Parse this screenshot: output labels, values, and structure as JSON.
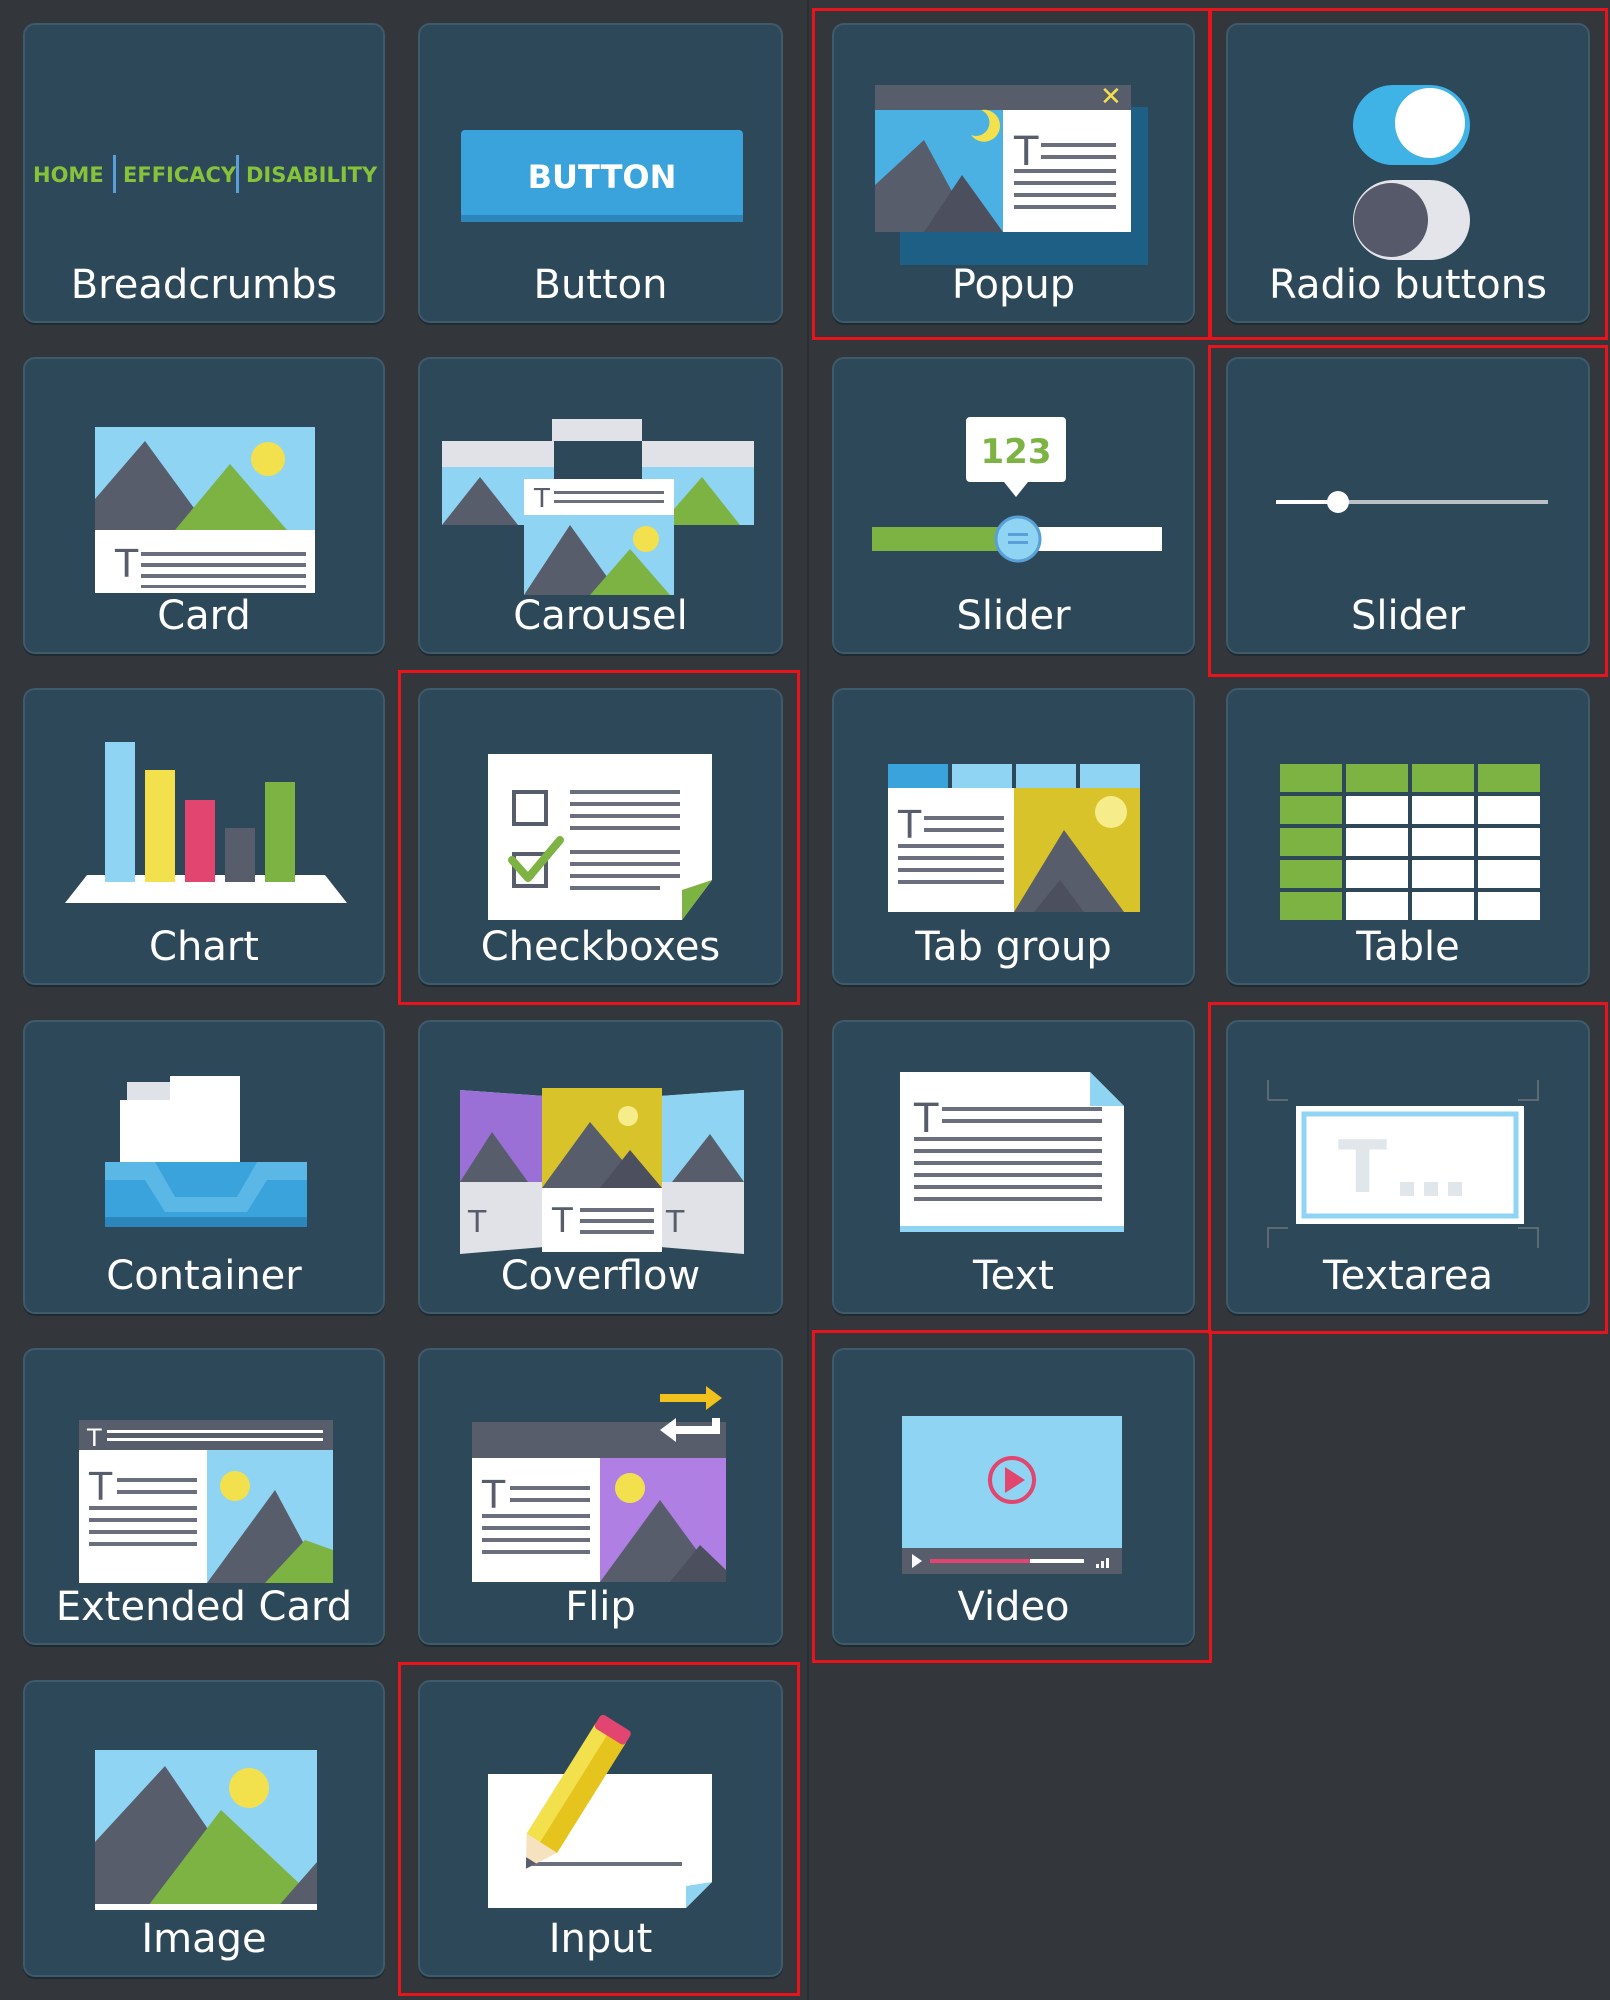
{
  "tiles": [
    {
      "label": "Breadcrumbs",
      "icon": "breadcrumbs-icon",
      "crumbs": [
        "HOME",
        "EFFICACY",
        "DISABILITY"
      ]
    },
    {
      "label": "Button",
      "icon": "button-icon",
      "sample_text": "BUTTON"
    },
    {
      "label": "Popup",
      "icon": "popup-icon"
    },
    {
      "label": "Radio buttons",
      "icon": "toggle-switch-icon"
    },
    {
      "label": "Card",
      "icon": "card-icon"
    },
    {
      "label": "Carousel",
      "icon": "carousel-icon"
    },
    {
      "label": "Slider",
      "icon": "slider-value-icon",
      "sample_value": "123"
    },
    {
      "label": "Slider",
      "icon": "slider-simple-icon"
    },
    {
      "label": "Chart",
      "icon": "bar-chart-icon"
    },
    {
      "label": "Checkboxes",
      "icon": "checkboxes-icon"
    },
    {
      "label": "Tab group",
      "icon": "tab-group-icon"
    },
    {
      "label": "Table",
      "icon": "table-icon"
    },
    {
      "label": "Container",
      "icon": "container-tray-icon"
    },
    {
      "label": "Coverflow",
      "icon": "coverflow-icon"
    },
    {
      "label": "Text",
      "icon": "text-document-icon"
    },
    {
      "label": "Textarea",
      "icon": "textarea-icon"
    },
    {
      "label": "Extended Card",
      "icon": "extended-card-icon"
    },
    {
      "label": "Flip",
      "icon": "flip-card-icon"
    },
    {
      "label": "Video",
      "icon": "video-player-icon"
    },
    {
      "label": "Image",
      "icon": "image-landscape-icon"
    },
    {
      "label": "Input",
      "icon": "input-pencil-icon"
    }
  ],
  "colors": {
    "background": "#33373b",
    "tile": "#2d4859",
    "highlight": "#e8141c",
    "accent_blue": "#3aa3dc",
    "accent_green": "#7cb342",
    "accent_yellow": "#f2e14c",
    "accent_pink": "#e2456f",
    "accent_purple": "#b07fe4"
  }
}
